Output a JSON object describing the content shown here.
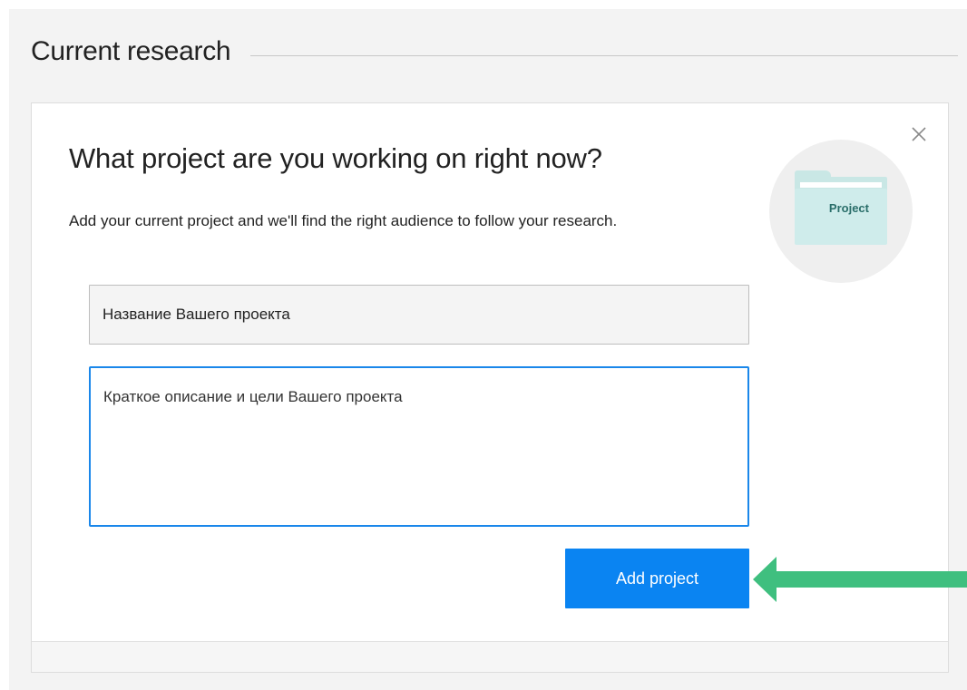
{
  "section": {
    "title": "Current research"
  },
  "card": {
    "heading": "What project are you working on right now?",
    "description": "Add your current project and we'll find the right audience to follow your research.",
    "illustration_label": "Project",
    "title_input_value": "Название Вашего проекта",
    "description_input_value": "Краткое описание и цели Вашего проекта",
    "add_button_label": "Add project"
  },
  "icons": {
    "close": "close-icon",
    "illustration": "folder-icon",
    "pointer": "arrow-left-icon"
  },
  "colors": {
    "accent": "#0a84f2",
    "focus_border": "#1a87ea",
    "annotation_arrow": "#3fbf7f",
    "folder": "#c9e7e5"
  }
}
